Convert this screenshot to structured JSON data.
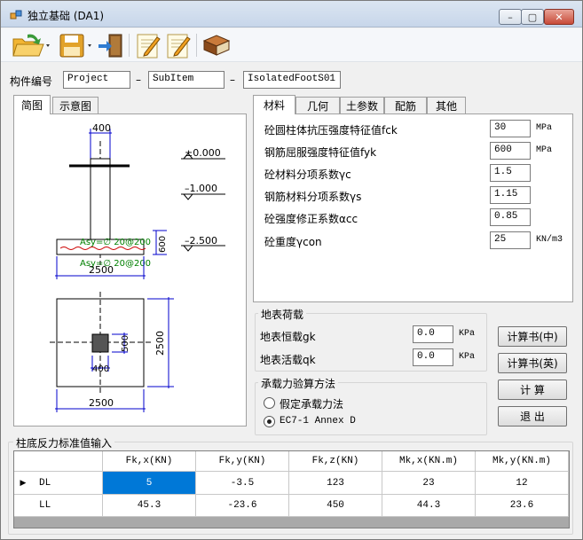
{
  "window": {
    "title": "独立基础 (DA1)",
    "controls": {
      "minimize": "–",
      "maximize": "▢",
      "close": "✕"
    }
  },
  "toolbar": {
    "buttons": [
      {
        "name": "open",
        "icon": "folder-open-icon"
      },
      {
        "name": "save",
        "icon": "floppy-disk-icon"
      },
      {
        "name": "exit",
        "icon": "exit-door-icon"
      },
      {
        "name": "edit1",
        "icon": "pencil-note-icon"
      },
      {
        "name": "edit2",
        "icon": "pencil-note-icon"
      },
      {
        "name": "help",
        "icon": "book-icon"
      }
    ]
  },
  "member_id": {
    "label": "构件编号",
    "project": "Project",
    "subitem": "SubItem",
    "element": "IsolatedFootS01",
    "separator": "–"
  },
  "left_tabs": {
    "tab1": "简图",
    "tab2": "示意图"
  },
  "drawing": {
    "col_width": "400",
    "elev_top": "±0.000",
    "elev_mid": "–1.000",
    "elev_bot": "–2.500",
    "depth": "600",
    "rebar_top": "Asy=∅ 20@200",
    "rebar_bot": "Asy=∅ 20@200",
    "base_width": "2500",
    "plan_width": "2500",
    "plan_height": "2500",
    "plan_col_w": "400",
    "plan_col_h": "500"
  },
  "right_tabs": [
    "材料",
    "几何",
    "土参数",
    "配筋",
    "其他"
  ],
  "material": {
    "fields": [
      {
        "label": "砼圆柱体抗压强度特征值fck",
        "value": "30",
        "unit": "MPa"
      },
      {
        "label": "钢筋屈服强度特征值fyk",
        "value": "600",
        "unit": "MPa"
      },
      {
        "label": "砼材料分项系数γc",
        "value": "1.5",
        "unit": ""
      },
      {
        "label": "钢筋材料分项系数γs",
        "value": "1.15",
        "unit": ""
      },
      {
        "label": "砼强度修正系数αcc",
        "value": "0.85",
        "unit": ""
      },
      {
        "label": "砼重度γcon",
        "value": "25",
        "unit": "KN/m3"
      }
    ]
  },
  "surface_load": {
    "title": "地表荷载",
    "dead_label": "地表恒载gk",
    "dead_value": "0.0",
    "dead_unit": "KPa",
    "live_label": "地表活载qk",
    "live_value": "0.0",
    "live_unit": "KPa"
  },
  "method": {
    "title": "承载力验算方法",
    "option1": "假定承载力法",
    "option2": "EC7-1 Annex D",
    "selected": "option2"
  },
  "actions": {
    "report_cn": "计算书(中)",
    "report_en": "计算书(英)",
    "calculate": "计 算",
    "exit": "退 出"
  },
  "reaction": {
    "title": "柱底反力标准值输入",
    "columns": [
      "Fk,x(KN)",
      "Fk,y(KN)",
      "Fk,z(KN)",
      "Mk,x(KN.m)",
      "Mk,y(KN.m)"
    ],
    "rows": [
      {
        "name": "DL",
        "values": [
          "5",
          "-3.5",
          "123",
          "23",
          "12"
        ]
      },
      {
        "name": "LL",
        "values": [
          "45.3",
          "-23.6",
          "450",
          "44.3",
          "23.6"
        ]
      }
    ],
    "current_row_marker": "▶"
  },
  "colors": {
    "selection": "#0078d7",
    "rebar": "#cc0000",
    "rebar_label": "#008000",
    "dimension": "#0000cc"
  }
}
